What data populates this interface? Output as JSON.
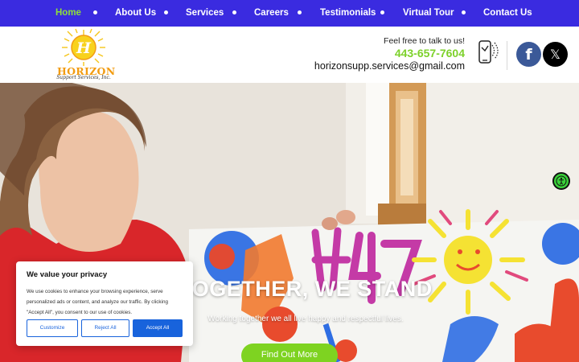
{
  "nav": {
    "items": [
      {
        "label": "Home",
        "active": true
      },
      {
        "label": "About Us"
      },
      {
        "label": "Services"
      },
      {
        "label": "Careers"
      },
      {
        "label": "Testimonials"
      },
      {
        "label": "Virtual Tour"
      },
      {
        "label": "Contact Us"
      }
    ]
  },
  "header": {
    "logo": {
      "name": "HORIZON",
      "subline": "Support Services, Inc."
    },
    "tagline": "Feel free to talk to us!",
    "phone": "443-657-7604",
    "email": "horizonsupp.services@gmail.com",
    "social": {
      "facebook_glyph": "f",
      "x_glyph": "𝕏"
    }
  },
  "hero": {
    "title": "TOGETHER, WE STAND",
    "subtitle": "Working together we all live happy and respectful lives.",
    "button": "Find Out More"
  },
  "cookie": {
    "title": "We value your privacy",
    "body": "We use cookies to enhance your browsing experience, serve personalized ads or content, and analyze our traffic. By clicking \"Accept All\", you consent to our use of cookies.",
    "customize": "Customize",
    "reject": "Reject All",
    "accept": "Accept All"
  },
  "colors": {
    "nav_bg": "#3a2be0",
    "nav_active": "#8ee03a",
    "phone": "#7dd12b",
    "button_green": "#7ed321",
    "cookie_blue": "#1863dc"
  }
}
